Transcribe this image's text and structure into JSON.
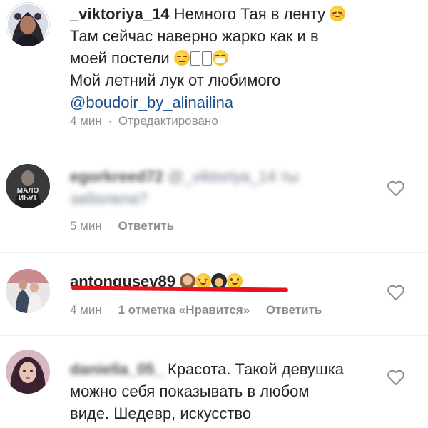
{
  "comments": [
    {
      "username": "_viktoriya_14",
      "lines": [
        "Немного Тая в ленту",
        "Там сейчас наверно жарко как и в",
        "моей постели",
        "Мой летний лук от любимого"
      ],
      "mention": "@boudoir_by_alinailina",
      "time": "4 мин",
      "separator": "·",
      "edited": "Отредактировано"
    },
    {
      "username_blurred": "egorkreed72",
      "text_blurred_1": "@_viktoriya_14 ты",
      "text_blurred_2": "заболела?",
      "avatar_text": "МАЛО ТАЧИ",
      "time": "5 мин",
      "reply": "Ответить"
    },
    {
      "username": "antongusev89",
      "time": "4 мин",
      "likes": "1 отметка «Нравится»",
      "reply": "Ответить"
    },
    {
      "username_blurred": "daniella_05_",
      "lines": [
        "Красота. Такой девушка",
        "можно себя показывать в любом",
        "виде. Шедевр, искусство"
      ]
    }
  ],
  "colors": {
    "mention": "#1a4f8e",
    "meta": "#8e8e8e",
    "highlight": "#e8121c"
  },
  "icons": [
    "heart-icon",
    "smiling-face-icon",
    "expressionless-face-icon",
    "face-with-mask-icon",
    "see-no-evil-monkey-icon",
    "heart-eyes-face-icon",
    "person-icon",
    "slightly-smiling-face-icon"
  ]
}
